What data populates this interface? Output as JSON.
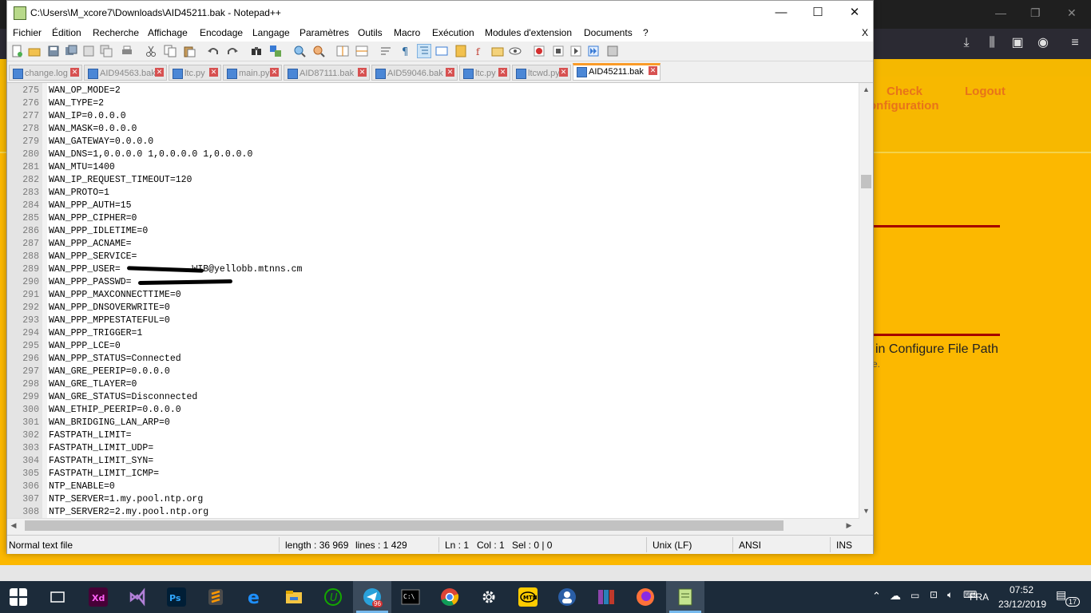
{
  "window": {
    "title": "C:\\Users\\M_xcore7\\Downloads\\AID45211.bak - Notepad++",
    "minimize": "—",
    "maximize": "☐",
    "close": "✕"
  },
  "menu": {
    "items": [
      "Fichier",
      "Édition",
      "Recherche",
      "Affichage",
      "Encodage",
      "Langage",
      "Paramètres",
      "Outils",
      "Macro",
      "Exécution",
      "Modules d'extension",
      "Documents",
      "?"
    ],
    "close": "X"
  },
  "tabs": [
    {
      "label": "change.log",
      "active": false
    },
    {
      "label": "AID94563.bak",
      "active": false
    },
    {
      "label": "ltc.py",
      "active": false
    },
    {
      "label": "main.py",
      "active": false
    },
    {
      "label": "AID87111.bak",
      "active": false
    },
    {
      "label": "AID59046.bak",
      "active": false
    },
    {
      "label": "ltc.py",
      "active": false
    },
    {
      "label": "ltcwd.py",
      "active": false
    },
    {
      "label": "AID45211.bak",
      "active": true
    }
  ],
  "editor": {
    "lines": [
      {
        "n": "275",
        "t": "WAN_OP_MODE=2"
      },
      {
        "n": "276",
        "t": "WAN_TYPE=2"
      },
      {
        "n": "277",
        "t": "WAN_IP=0.0.0.0"
      },
      {
        "n": "278",
        "t": "WAN_MASK=0.0.0.0"
      },
      {
        "n": "279",
        "t": "WAN_GATEWAY=0.0.0.0"
      },
      {
        "n": "280",
        "t": "WAN_DNS=1,0.0.0.0 1,0.0.0.0 1,0.0.0.0"
      },
      {
        "n": "281",
        "t": "WAN_MTU=1400"
      },
      {
        "n": "282",
        "t": "WAN_IP_REQUEST_TIMEOUT=120"
      },
      {
        "n": "283",
        "t": "WAN_PROTO=1"
      },
      {
        "n": "284",
        "t": "WAN_PPP_AUTH=15"
      },
      {
        "n": "285",
        "t": "WAN_PPP_CIPHER=0"
      },
      {
        "n": "286",
        "t": "WAN_PPP_IDLETIME=0"
      },
      {
        "n": "287",
        "t": "WAN_PPP_ACNAME="
      },
      {
        "n": "288",
        "t": "WAN_PPP_SERVICE="
      },
      {
        "n": "289",
        "t": "WAN_PPP_USER=             WIB@yellobb.mtnns.cm"
      },
      {
        "n": "290",
        "t": "WAN_PPP_PASSWD="
      },
      {
        "n": "291",
        "t": "WAN_PPP_MAXCONNECTTIME=0"
      },
      {
        "n": "292",
        "t": "WAN_PPP_DNSOVERWRITE=0"
      },
      {
        "n": "293",
        "t": "WAN_PPP_MPPESTATEFUL=0"
      },
      {
        "n": "294",
        "t": "WAN_PPP_TRIGGER=1"
      },
      {
        "n": "295",
        "t": "WAN_PPP_LCE=0"
      },
      {
        "n": "296",
        "t": "WAN_PPP_STATUS=Connected"
      },
      {
        "n": "297",
        "t": "WAN_GRE_PEERIP=0.0.0.0"
      },
      {
        "n": "298",
        "t": "WAN_GRE_TLAYER=0"
      },
      {
        "n": "299",
        "t": "WAN_GRE_STATUS=Disconnected"
      },
      {
        "n": "300",
        "t": "WAN_ETHIP_PEERIP=0.0.0.0"
      },
      {
        "n": "301",
        "t": "WAN_BRIDGING_LAN_ARP=0"
      },
      {
        "n": "302",
        "t": "FASTPATH_LIMIT="
      },
      {
        "n": "303",
        "t": "FASTPATH_LIMIT_UDP="
      },
      {
        "n": "304",
        "t": "FASTPATH_LIMIT_SYN="
      },
      {
        "n": "305",
        "t": "FASTPATH_LIMIT_ICMP="
      },
      {
        "n": "306",
        "t": "NTP_ENABLE=0"
      },
      {
        "n": "307",
        "t": "NTP_SERVER=1.my.pool.ntp.org"
      },
      {
        "n": "308",
        "t": "NTP_SERVER2=2.my.pool.ntp.org"
      }
    ]
  },
  "status": {
    "filetype": "Normal text file",
    "length": "length : 36 969",
    "lines": "lines : 1 429",
    "ln": "Ln : 1",
    "col": "Col : 1",
    "sel": "Sel : 0 | 0",
    "eol": "Unix (LF)",
    "encoding": "ANSI",
    "mode": "INS"
  },
  "background_page": {
    "link_check": "Check",
    "link_configuration": "onfiguration",
    "link_logout": "Logout",
    "text_path": "in Configure File Path",
    "text_dot": "e."
  },
  "taskbar": {
    "language": "FRA",
    "time": "07:52",
    "date": "23/12/2019",
    "notifications": "17",
    "telegram_badge": "96"
  },
  "colors": {
    "accent_tab": "#fa9b28",
    "page_yellow": "#fcb800",
    "link_orange": "#e8731a",
    "taskbar": "#1c2b3a"
  }
}
